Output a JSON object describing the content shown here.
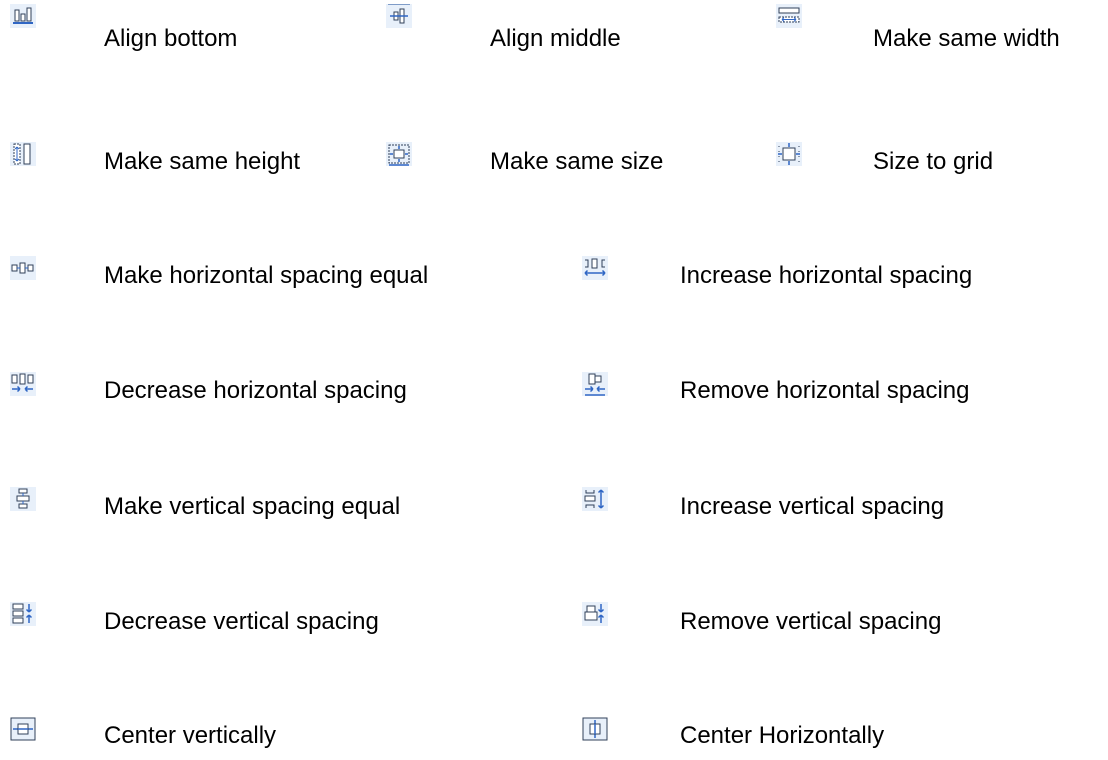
{
  "items": [
    {
      "icon": "align-bottom-icon",
      "label": "Align bottom"
    },
    {
      "icon": "align-middle-icon",
      "label": "Align middle"
    },
    {
      "icon": "make-same-width-icon",
      "label": "Make same width"
    },
    {
      "icon": "make-same-height-icon",
      "label": "Make same height"
    },
    {
      "icon": "make-same-size-icon",
      "label": "Make same size"
    },
    {
      "icon": "size-to-grid-icon",
      "label": "Size to grid"
    },
    {
      "icon": "make-horizontal-spacing-equal-icon",
      "label": "Make horizontal spacing equal"
    },
    {
      "icon": "increase-horizontal-spacing-icon",
      "label": "Increase horizontal spacing"
    },
    {
      "icon": "decrease-horizontal-spacing-icon",
      "label": "Decrease horizontal spacing"
    },
    {
      "icon": "remove-horizontal-spacing-icon",
      "label": "Remove horizontal spacing"
    },
    {
      "icon": "make-vertical-spacing-equal-icon",
      "label": "Make vertical spacing equal"
    },
    {
      "icon": "increase-vertical-spacing-icon",
      "label": "Increase vertical spacing"
    },
    {
      "icon": "decrease-vertical-spacing-icon",
      "label": "Decrease vertical spacing"
    },
    {
      "icon": "remove-vertical-spacing-icon",
      "label": "Remove vertical spacing"
    },
    {
      "icon": "center-vertically-icon",
      "label": "Center vertically"
    },
    {
      "icon": "center-horizontally-icon",
      "label": "Center Horizontally"
    }
  ],
  "colors": {
    "icon_fill": "#dce9f7",
    "icon_stroke": "#2f66c4",
    "icon_dark": "#30405a",
    "text": "#000000"
  }
}
